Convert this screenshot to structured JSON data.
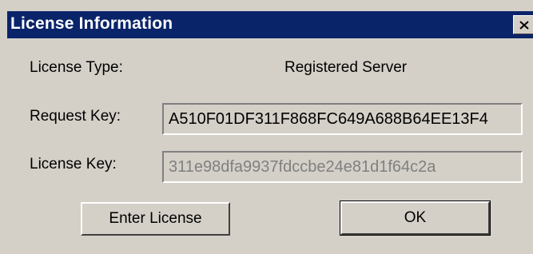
{
  "window": {
    "title": "License Information",
    "close_icon": "close-icon"
  },
  "license_type": {
    "label": "License Type:",
    "value": "Registered Server"
  },
  "request_key": {
    "label": "Request Key:",
    "value": "A510F01DF311F868FC649A688B64EE13F4"
  },
  "license_key": {
    "label": "License Key:",
    "value": "311e98dfa9937fdccbe24e81d1f64c2a"
  },
  "buttons": {
    "enter_license": "Enter License",
    "ok": "OK"
  },
  "colors": {
    "titlebar": "#0a246a",
    "dialog_background": "#d4d0c8",
    "disabled_text": "#808080"
  }
}
